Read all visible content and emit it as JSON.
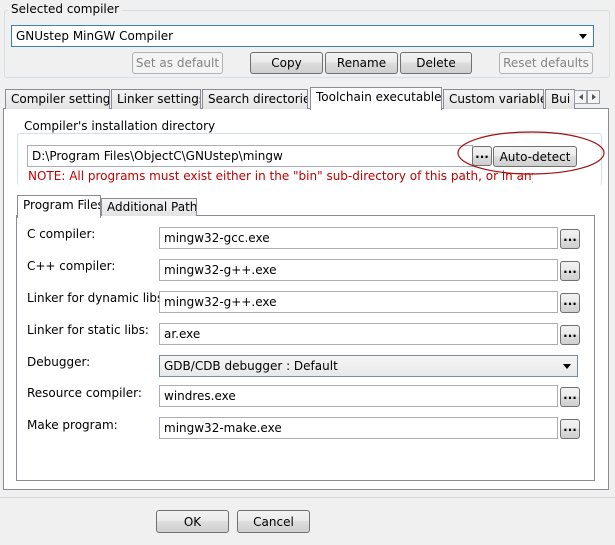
{
  "selected_compiler": {
    "legend": "Selected compiler",
    "value": "GNUstep MinGW Compiler",
    "buttons": {
      "set_default": "Set as default",
      "copy": "Copy",
      "rename": "Rename",
      "delete": "Delete",
      "reset_defaults": "Reset defaults"
    }
  },
  "tabs": {
    "compiler_settings": "Compiler settings",
    "linker_settings": "Linker settings",
    "search_directories": "Search directories",
    "toolchain_executables": "Toolchain executables",
    "custom_variables": "Custom variables",
    "build_options": "Bui"
  },
  "install_dir": {
    "legend": "Compiler's installation directory",
    "path": "D:\\Program Files\\ObjectC\\GNUstep\\mingw",
    "browse": "...",
    "autodetect": "Auto-detect",
    "note": "NOTE: All programs must exist either in the \"bin\" sub-directory of this path, or in any of the"
  },
  "subtabs": {
    "program_files": "Program Files",
    "additional_paths": "Additional Paths"
  },
  "programs": {
    "c_compiler": {
      "label": "C compiler:",
      "value": "mingw32-gcc.exe"
    },
    "cpp_compiler": {
      "label": "C++ compiler:",
      "value": "mingw32-g++.exe"
    },
    "linker_dynamic": {
      "label": "Linker for dynamic libs:",
      "value": "mingw32-g++.exe"
    },
    "linker_static": {
      "label": "Linker for static libs:",
      "value": "ar.exe"
    },
    "debugger": {
      "label": "Debugger:",
      "value": "GDB/CDB debugger : Default"
    },
    "resource_compiler": {
      "label": "Resource compiler:",
      "value": "windres.exe"
    },
    "make_program": {
      "label": "Make program:",
      "value": "mingw32-make.exe"
    },
    "browse": "..."
  },
  "dialog": {
    "ok": "OK",
    "cancel": "Cancel"
  },
  "colors": {
    "note_text": "#c00000",
    "highlight_ellipse": "#a01010"
  }
}
